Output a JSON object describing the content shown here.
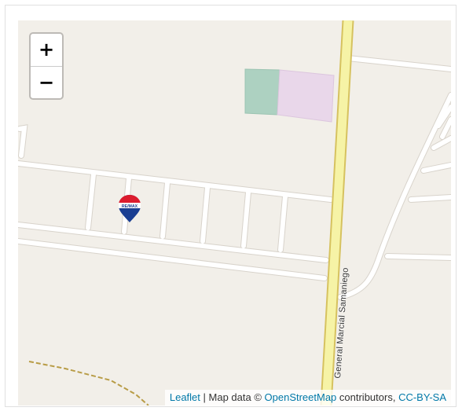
{
  "map": {
    "zoom_in_label": "+",
    "zoom_out_label": "−",
    "road_name": "General Marcial Samaniego",
    "marker_text": "RE/MAX",
    "marker_icon": "remax-balloon-icon",
    "colors": {
      "land": "#f2efe9",
      "minor_road": "#ffffff",
      "primary_road": "#f6f3a6",
      "primary_road_casing": "#d6c25f",
      "park": "#add1c1",
      "commercial": "#e9d7ea",
      "track": "#b89c46",
      "link": "#0078a8"
    }
  },
  "attribution": {
    "leaflet": "Leaflet",
    "separator": " | Map data © ",
    "osm": "OpenStreetMap",
    "contributors": " contributors, ",
    "license": "CC-BY-SA"
  }
}
